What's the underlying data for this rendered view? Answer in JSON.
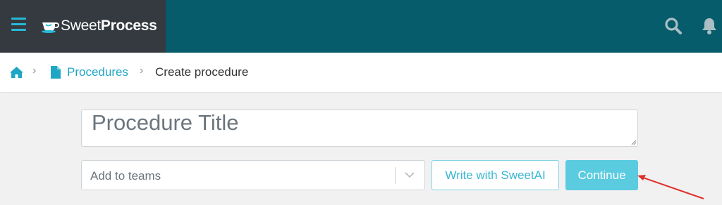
{
  "header": {
    "brand": {
      "light": "Sweet",
      "bold": "Process"
    },
    "menu_icon": "hamburger-menu-icon",
    "search_icon": "search-icon",
    "notifications_icon": "bell-icon"
  },
  "breadcrumb": {
    "home_icon": "home-icon",
    "items": [
      {
        "label": "Procedures",
        "icon": "document-icon"
      },
      {
        "label": "Create procedure"
      }
    ]
  },
  "form": {
    "title_placeholder": "Procedure Title",
    "teams_placeholder": "Add to teams",
    "ai_button_label": "Write with SweetAI",
    "continue_label": "Continue"
  },
  "colors": {
    "header": "#065c6b",
    "brand_panel": "#343a40",
    "accent": "#27b9d6",
    "continue_button": "#5bcbe0",
    "annotation_arrow": "#e0302b"
  }
}
